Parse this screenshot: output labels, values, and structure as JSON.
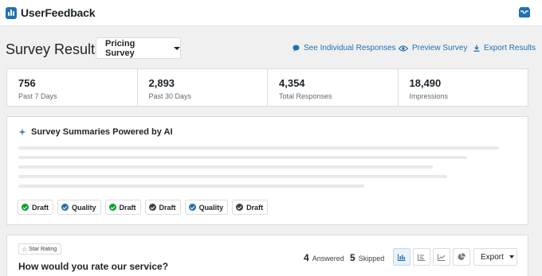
{
  "app": {
    "name": "UserFeedback"
  },
  "colors": {
    "accent": "#2271b1",
    "draft_check": "#00a32a",
    "quality_check": "#2271b1",
    "dark_check": "#3c434a"
  },
  "header": {
    "title": "Survey Results",
    "survey_select": "Pricing Survey",
    "links": {
      "individual": "See Individual Responses",
      "preview": "Preview Survey",
      "export": "Export Results"
    }
  },
  "stats": [
    {
      "value": "756",
      "label": "Past 7 Days"
    },
    {
      "value": "2,893",
      "label": "Past 30 Days"
    },
    {
      "value": "4,354",
      "label": "Total Responses"
    },
    {
      "value": "18,490",
      "label": "Impressions"
    }
  ],
  "ai_summary": {
    "title": "Survey Summaries Powered by AI",
    "chips": [
      {
        "label": "Draft",
        "check": "green"
      },
      {
        "label": "Quality",
        "check": "blue"
      },
      {
        "label": "Draft",
        "check": "green"
      },
      {
        "label": "Draft",
        "check": "dark"
      },
      {
        "label": "Quality",
        "check": "blue"
      },
      {
        "label": "Draft",
        "check": "dark"
      }
    ]
  },
  "question": {
    "type_badge": "Star Rating",
    "title": "How would you rate our service?",
    "answered_count": "4",
    "answered_label": "Answered",
    "skipped_count": "5",
    "skipped_label": "Skipped",
    "view_buttons": [
      "bar-chart-icon",
      "list-icon",
      "line-chart-icon",
      "pie-chart-icon"
    ],
    "export_label": "Export"
  }
}
